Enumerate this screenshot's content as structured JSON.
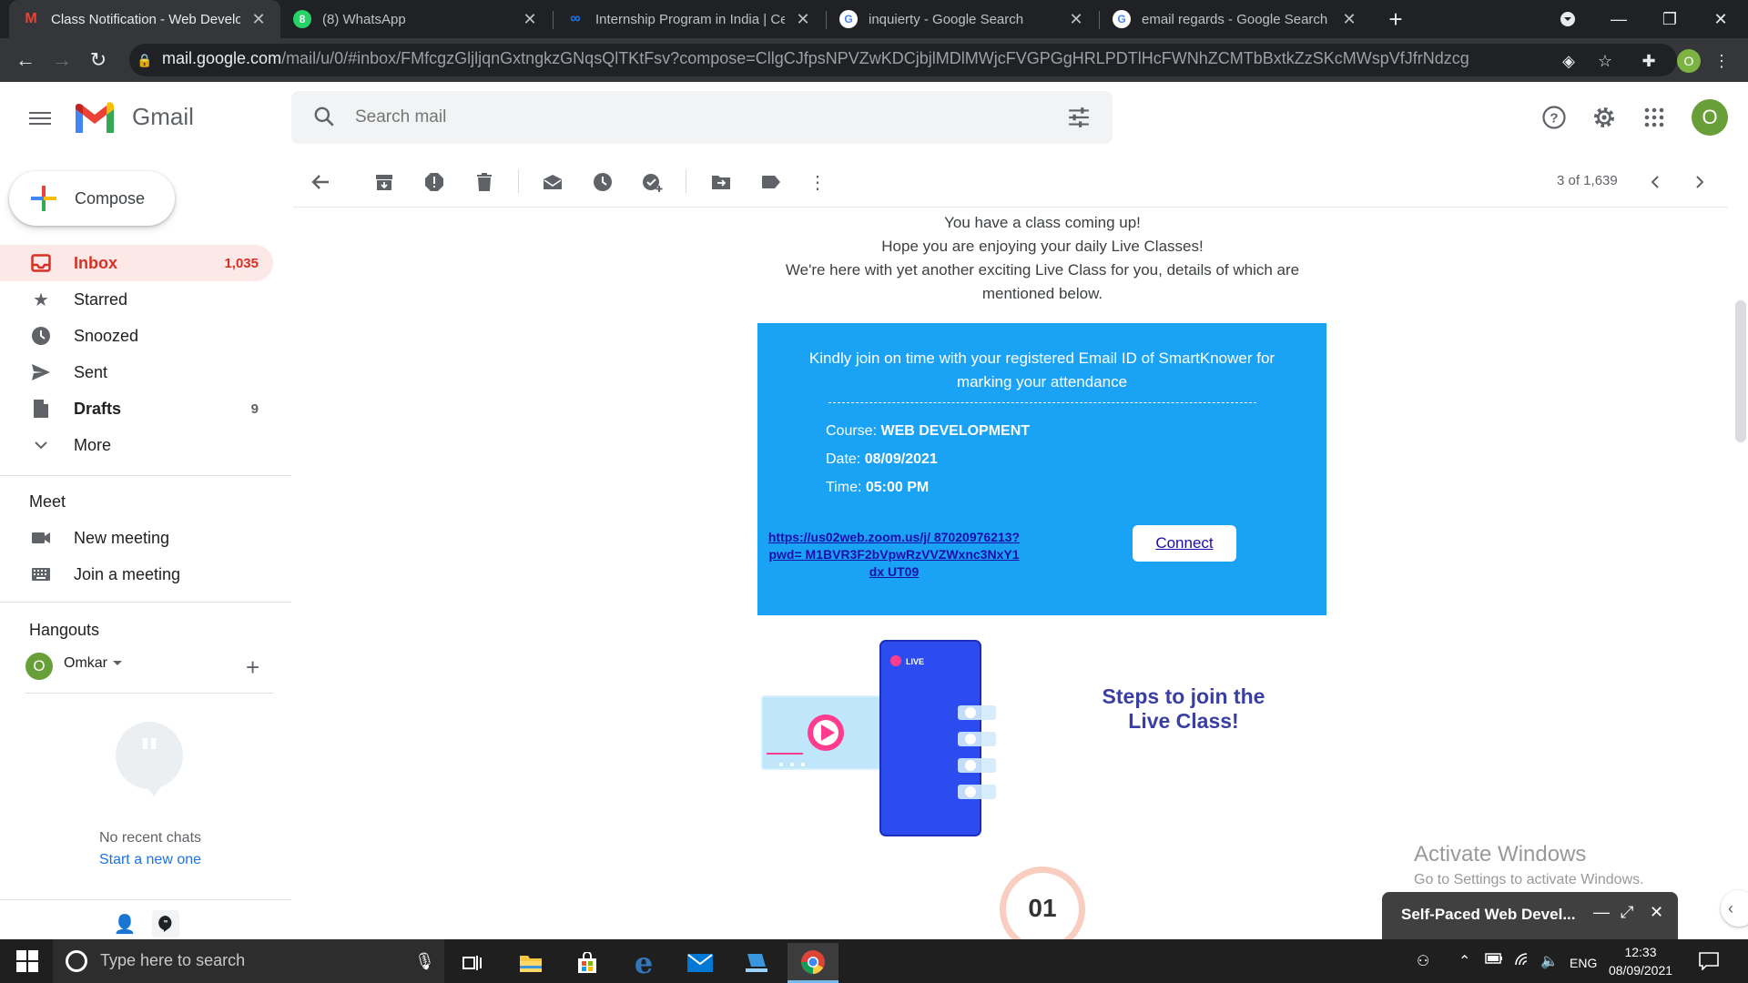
{
  "browser": {
    "tabs": [
      {
        "title": "Class Notification - Web Develop",
        "favicon": "gmail-icon"
      },
      {
        "title": "(8) WhatsApp",
        "favicon": "whatsapp-icon"
      },
      {
        "title": "Internship Program in India | Cer",
        "favicon": "meta-icon"
      },
      {
        "title": "inquierty - Google Search",
        "favicon": "google-icon"
      },
      {
        "title": "email regards - Google Search",
        "favicon": "google-icon"
      }
    ],
    "url_host": "mail.google.com",
    "url_path": "/mail/u/0/#inbox/FMfcgzGljljqnGxtngkzGNqsQlTKtFsv?compose=CllgCJfpsNPVZwKDCjbjlMDlMWjcFVGPGgHRLPDTlHcFWNhZCMTbBxtkZzSKcMWspVfJfrNdzcg",
    "profile_initial": "O"
  },
  "gmail": {
    "app_name": "Gmail",
    "search_placeholder": "Search mail",
    "user_initial": "O",
    "compose_label": "Compose",
    "nav": [
      {
        "label": "Inbox",
        "count": "1,035"
      },
      {
        "label": "Starred",
        "count": ""
      },
      {
        "label": "Snoozed",
        "count": ""
      },
      {
        "label": "Sent",
        "count": ""
      },
      {
        "label": "Drafts",
        "count": "9"
      },
      {
        "label": "More",
        "count": ""
      }
    ],
    "meet": {
      "heading": "Meet",
      "new_meeting": "New meeting",
      "join_meeting": "Join a meeting"
    },
    "hangouts": {
      "heading": "Hangouts",
      "user_initial": "O",
      "user_name": "Omkar",
      "no_recent": "No recent chats",
      "start_new": "Start a new one"
    },
    "pagination": "3 of 1,639"
  },
  "email": {
    "intro_line1": "You have a class coming up!",
    "intro_line2": "Hope you are enjoying your daily Live Classes!",
    "intro_line3": "We're here with yet another exciting Live Class for you, details of which are mentioned below.",
    "notice": "Kindly join on time with your registered Email ID of  SmartKnower for marking your attendance",
    "course_label": "Course: ",
    "course_value": "WEB DEVELOPMENT",
    "date_label": "Date: ",
    "date_value": "08/09/2021",
    "time_label": "Time: ",
    "time_value": "05:00 PM",
    "zoom_link": "https://us02web.zoom.us/j/ 87020976213?pwd= M1BVR3F2bVpwRzVVZWxnc3NxY1dx UT09",
    "connect_label": "Connect",
    "live_badge": "LIVE",
    "steps_title": "Steps to join the Live Class!",
    "step_number": "01"
  },
  "overlays": {
    "activate_title": "Activate Windows",
    "activate_sub": "Go to Settings to activate Windows.",
    "chat_popup_title": "Self-Paced Web Devel..."
  },
  "taskbar": {
    "search_placeholder": "Type here to search",
    "language": "ENG",
    "time": "12:33",
    "date": "08/09/2021"
  },
  "colors": {
    "gmail_red": "#d93025",
    "inbox_highlight": "#fce8e6",
    "email_blue": "#1aa3f5",
    "steps_text": "#3a3fa3",
    "avatar_green": "#689f38"
  }
}
